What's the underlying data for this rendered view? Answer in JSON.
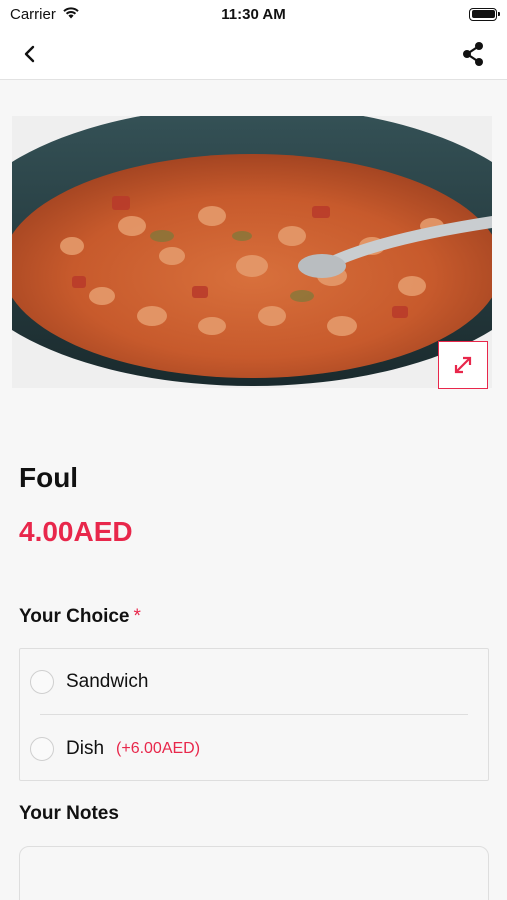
{
  "status_bar": {
    "carrier": "Carrier",
    "time": "11:30 AM",
    "battery_level": 1.0
  },
  "nav": {
    "back_icon": "chevron-left-icon",
    "share_icon": "share-icon"
  },
  "product": {
    "image_icon": "food-photo",
    "expand_icon": "expand-arrows-icon",
    "name": "Foul",
    "price": "4.00AED"
  },
  "choice_section": {
    "title": "Your Choice",
    "required_marker": "*",
    "options": [
      {
        "label": "Sandwich",
        "extra": "",
        "selected": false
      },
      {
        "label": "Dish",
        "extra": "(+6.00AED)",
        "selected": false
      }
    ]
  },
  "notes_section": {
    "title": "Your Notes",
    "value": "",
    "placeholder": ""
  },
  "colors": {
    "accent": "#e8274b",
    "background": "#f7f7f7",
    "text": "#111111"
  }
}
